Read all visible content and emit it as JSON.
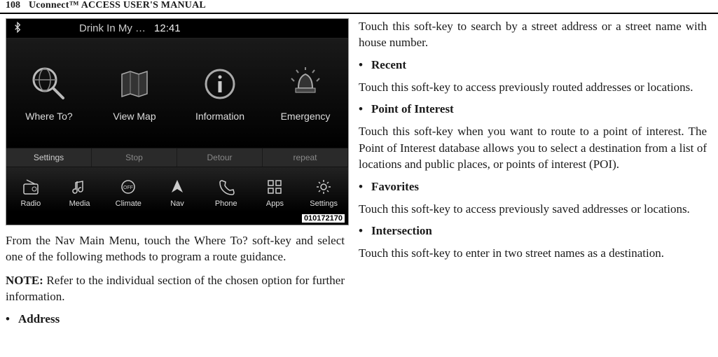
{
  "header": {
    "page_number": "108",
    "title": "Uconnect™ ACCESS USER'S MANUAL"
  },
  "screenshot": {
    "status_bar": {
      "song": "Drink In My …",
      "time": "12:41"
    },
    "main_tiles": [
      {
        "label": "Where To?"
      },
      {
        "label": "View Map"
      },
      {
        "label": "Information"
      },
      {
        "label": "Emergency"
      }
    ],
    "mid_buttons": [
      {
        "label": "Settings"
      },
      {
        "label": "Stop"
      },
      {
        "label": "Detour"
      },
      {
        "label": "repeat"
      }
    ],
    "bottom_buttons": [
      {
        "label": "Radio"
      },
      {
        "label": "Media"
      },
      {
        "label": "Climate"
      },
      {
        "label": "Nav"
      },
      {
        "label": "Phone"
      },
      {
        "label": "Apps"
      },
      {
        "label": "Settings"
      }
    ],
    "image_id": "010172170"
  },
  "left_body": {
    "para1": "From the Nav Main Menu, touch the Where To? soft-key and select one of the following methods to program a route guidance.",
    "note_label": "NOTE:",
    "note_text": " Refer to the individual section of the chosen option for further information.",
    "bullet1": "Address"
  },
  "right_body": {
    "para1": "Touch this soft-key to search by a street address or a street name with house number.",
    "bullet1": "Recent",
    "para2": "Touch this soft-key to access previously routed addresses or locations.",
    "bullet2": "Point of Interest",
    "para3": "Touch this soft-key when you want to route to a point of interest. The Point of Interest database allows you to select a destination from a list of locations and public places, or points of interest (POI).",
    "bullet3": "Favorites",
    "para4": "Touch this soft-key to access previously saved addresses or locations.",
    "bullet4": "Intersection",
    "para5": "Touch this soft-key to enter in two street names as a destination."
  }
}
